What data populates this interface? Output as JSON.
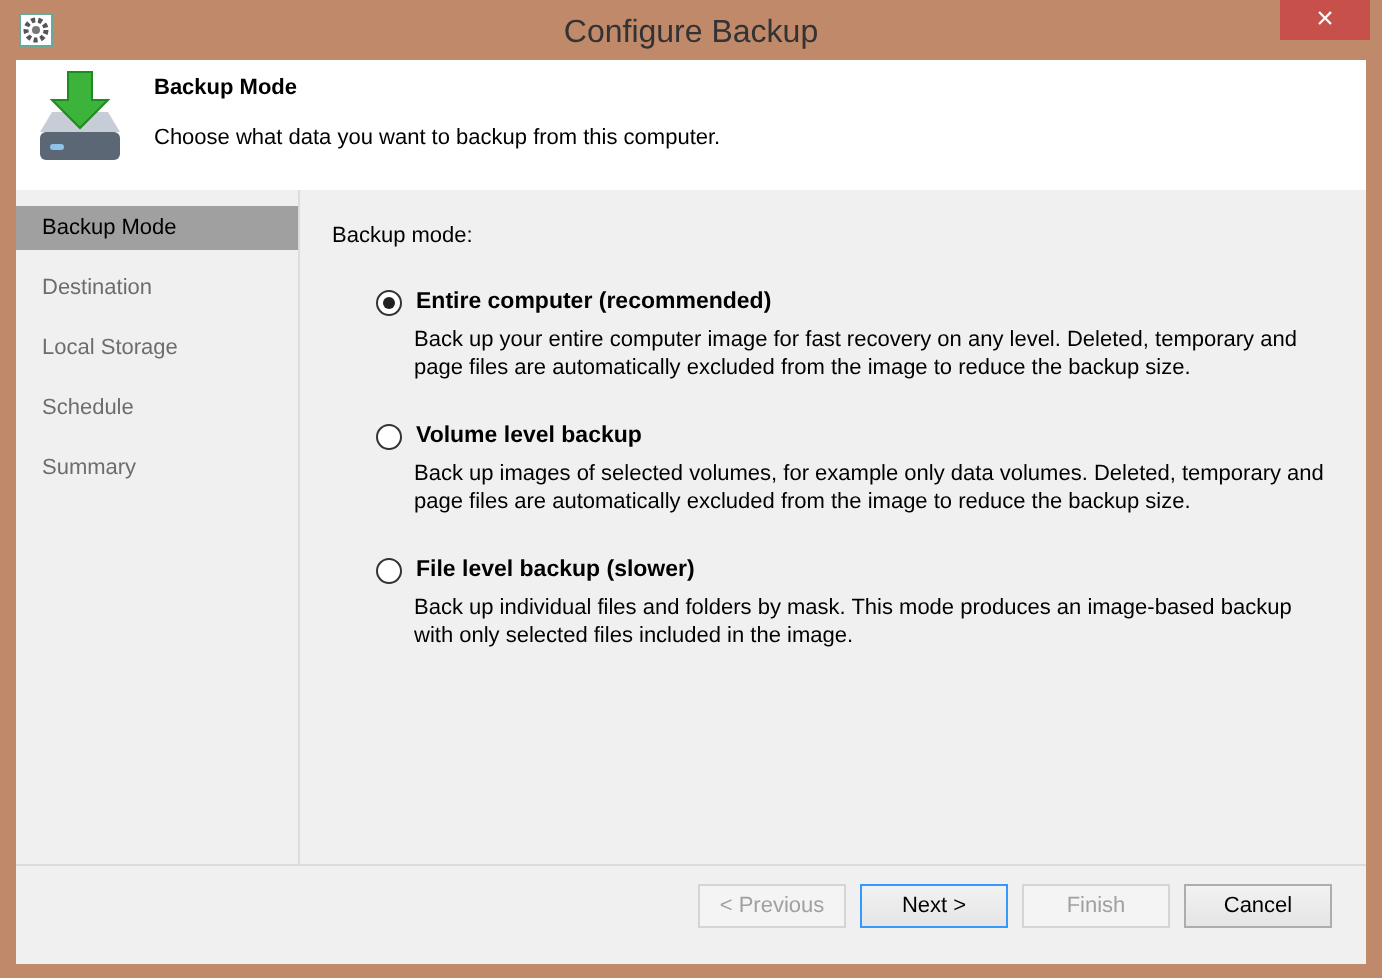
{
  "window": {
    "title": "Configure Backup",
    "close": "×"
  },
  "header": {
    "title": "Backup Mode",
    "subtitle": "Choose what data you want to backup from this computer."
  },
  "sidebar": {
    "items": [
      {
        "label": "Backup Mode",
        "selected": true
      },
      {
        "label": "Destination",
        "selected": false
      },
      {
        "label": "Local Storage",
        "selected": false
      },
      {
        "label": "Schedule",
        "selected": false
      },
      {
        "label": "Summary",
        "selected": false
      }
    ]
  },
  "content": {
    "label": "Backup mode:",
    "options": [
      {
        "label": "Entire computer (recommended)",
        "selected": true,
        "description": "Back up your entire computer image for fast recovery on any level. Deleted, temporary and page files are automatically excluded from the image to reduce the backup size."
      },
      {
        "label": "Volume level backup",
        "selected": false,
        "description": "Back up images of selected volumes, for example only data volumes. Deleted, temporary and page files are automatically excluded from the image to reduce the backup size."
      },
      {
        "label": "File level backup (slower)",
        "selected": false,
        "description": "Back up individual files and folders by mask. This mode produces an image-based backup with only selected files included in the image."
      }
    ]
  },
  "buttons": [
    {
      "label": "< Previous",
      "disabled": true,
      "default": false
    },
    {
      "label": "Next >",
      "disabled": false,
      "default": true
    },
    {
      "label": "Finish",
      "disabled": true,
      "default": false
    },
    {
      "label": "Cancel",
      "disabled": false,
      "default": false
    }
  ]
}
